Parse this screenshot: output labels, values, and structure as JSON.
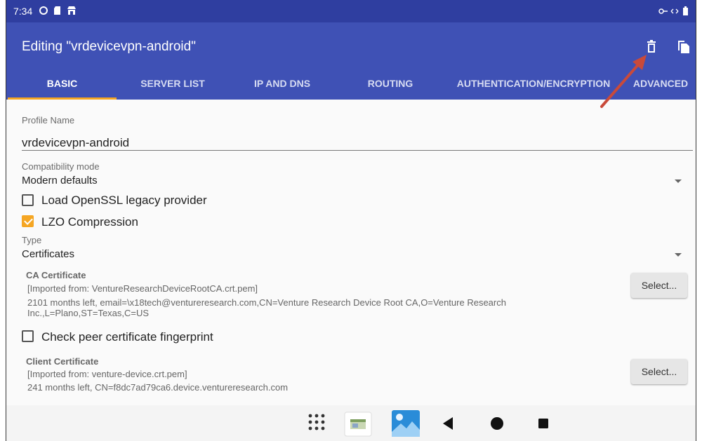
{
  "status_bar": {
    "time": "7:34",
    "icons": [
      "sync-icon",
      "sd-card-icon",
      "store-icon"
    ],
    "right_icons": [
      "vpn-key-icon",
      "vpn-arrows-icon",
      "battery-icon"
    ]
  },
  "app_bar": {
    "title": "Editing \"vrdevicevpn-android\"",
    "actions": [
      "delete-icon",
      "copy-icon"
    ],
    "color": "#3f51b5"
  },
  "tabs": [
    {
      "label": "BASIC",
      "active": true
    },
    {
      "label": "SERVER LIST",
      "active": false
    },
    {
      "label": "IP AND DNS",
      "active": false
    },
    {
      "label": "ROUTING",
      "active": false
    },
    {
      "label": "AUTHENTICATION/ENCRYPTION",
      "active": false
    },
    {
      "label": "ADVANCED",
      "active": false
    }
  ],
  "form": {
    "profile_name_label": "Profile Name",
    "profile_name_value": "vrdevicevpn-android",
    "compat_label": "Compatibility mode",
    "compat_value": "Modern defaults",
    "openssl_label": "Load OpenSSL legacy provider",
    "openssl_checked": false,
    "lzo_label": "LZO Compression",
    "lzo_checked": true,
    "type_label": "Type",
    "type_value": "Certificates",
    "ca": {
      "title": "CA Certificate",
      "line1": "[Imported from: VentureResearchDeviceRootCA.crt.pem]",
      "line2": "2101 months left, email=\\x18tech@ventureresearch.com,CN=Venture Research Device Root CA,O=Venture Research",
      "line3": "Inc.,L=Plano,ST=Texas,C=US",
      "button": "Select..."
    },
    "fingerprint_label": "Check peer certificate fingerprint",
    "fingerprint_checked": false,
    "client": {
      "title": "Client Certificate",
      "line1": "[Imported from: venture-device.crt.pem]",
      "line2": "241 months left, CN=f8dc7ad79ca6.device.ventureresearch.com",
      "button": "Select..."
    }
  },
  "nav_bar": {
    "items": [
      "app-drawer-icon",
      "recent-app-thumb-icon",
      "gallery-icon",
      "back-icon",
      "home-icon",
      "overview-icon"
    ]
  },
  "colors": {
    "accent": "#f5a623",
    "primary": "#3f51b5",
    "status_bar": "#2f3ea0",
    "annotation_arrow": "#c94a3a"
  }
}
